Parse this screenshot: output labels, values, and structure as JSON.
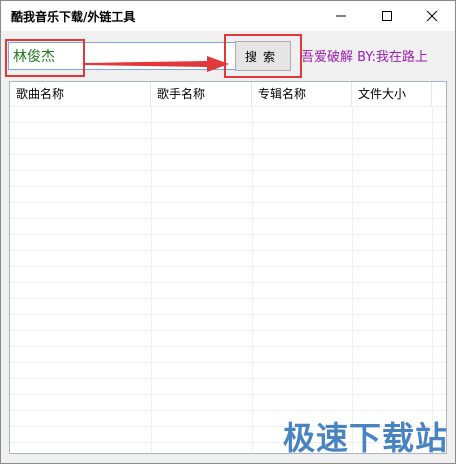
{
  "window": {
    "title": "酷我音乐下载/外链工具"
  },
  "search": {
    "value": "林俊杰",
    "button_label": "搜索"
  },
  "credit": "吾爱破解 BY:我在路上",
  "list": {
    "columns": [
      "歌曲名称",
      "歌手名称",
      "专辑名称",
      "文件大小"
    ]
  },
  "watermark": "极速下载站",
  "colors": {
    "highlight_frame": "#e0383b",
    "credit_text": "#9b1fb0",
    "input_text": "#1f7a1f",
    "watermark": "#2a6fb8"
  },
  "icons": [
    "minimize-icon",
    "maximize-icon",
    "close-icon",
    "arrow-right-icon"
  ]
}
